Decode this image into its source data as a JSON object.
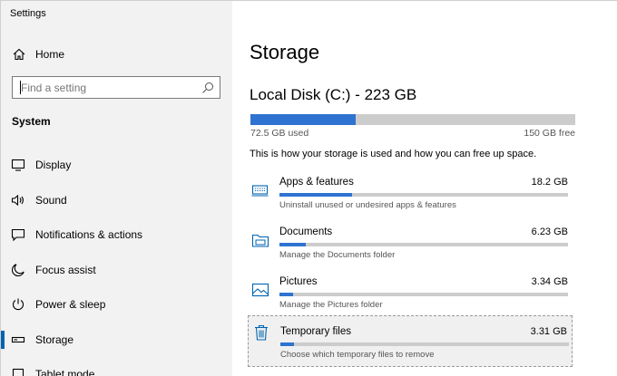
{
  "app": {
    "title": "Settings"
  },
  "sidebar": {
    "home_label": "Home",
    "search_placeholder": "Find a setting",
    "section_heading": "System",
    "items": [
      {
        "label": "Display",
        "icon": "display-icon"
      },
      {
        "label": "Sound",
        "icon": "speaker-icon"
      },
      {
        "label": "Notifications & actions",
        "icon": "notifications-icon"
      },
      {
        "label": "Focus assist",
        "icon": "moon-icon"
      },
      {
        "label": "Power & sleep",
        "icon": "power-icon"
      },
      {
        "label": "Storage",
        "icon": "storage-icon",
        "selected": true
      },
      {
        "label": "Tablet mode",
        "icon": "tablet-mode-icon"
      }
    ]
  },
  "main": {
    "title": "Storage",
    "disk": {
      "name": "Local Disk (C:) - 223 GB",
      "used_label": "72.5 GB used",
      "free_label": "150 GB free",
      "used_fraction": 0.325
    },
    "description": "This is how your storage is used and how you can free up space.",
    "categories": [
      {
        "name": "Apps & features",
        "size": "18.2 GB",
        "subtitle": "Uninstall unused or undesired apps & features",
        "fraction": 0.25,
        "icon": "apps-icon"
      },
      {
        "name": "Documents",
        "size": "6.23 GB",
        "subtitle": "Manage the Documents folder",
        "fraction": 0.09,
        "icon": "documents-folder-icon"
      },
      {
        "name": "Pictures",
        "size": "3.34 GB",
        "subtitle": "Manage the Pictures folder",
        "fraction": 0.047,
        "icon": "pictures-icon"
      },
      {
        "name": "Temporary files",
        "size": "3.31 GB",
        "subtitle": "Choose which temporary files to remove",
        "fraction": 0.047,
        "icon": "trash-icon",
        "focused": true
      }
    ]
  },
  "colors": {
    "accent": "#2f73d1",
    "selection_bar": "#0063b1",
    "sidebar_bg": "#f2f2f2",
    "track": "#cccccc"
  }
}
